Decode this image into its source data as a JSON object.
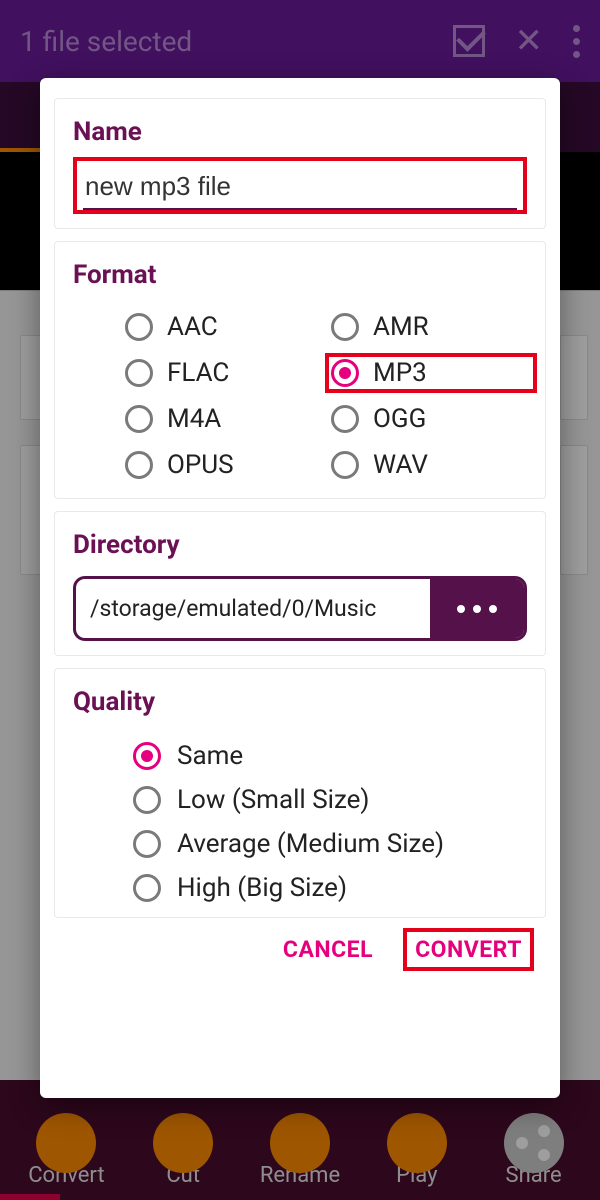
{
  "topbar": {
    "title": "1 file selected"
  },
  "bottombar": {
    "items": [
      "Convert",
      "Cut",
      "Rename",
      "Play",
      "Share"
    ]
  },
  "dialog": {
    "name": {
      "label": "Name",
      "value": "new mp3 file"
    },
    "format": {
      "label": "Format",
      "options": [
        "AAC",
        "AMR",
        "FLAC",
        "MP3",
        "M4A",
        "OGG",
        "OPUS",
        "WAV"
      ],
      "selected": "MP3"
    },
    "directory": {
      "label": "Directory",
      "path": "/storage/emulated/0/Music"
    },
    "quality": {
      "label": "Quality",
      "options": [
        "Same",
        "Low (Small Size)",
        "Average (Medium Size)",
        "High (Big Size)"
      ],
      "selected": "Same"
    },
    "actions": {
      "cancel": "CANCEL",
      "convert": "CONVERT"
    }
  }
}
